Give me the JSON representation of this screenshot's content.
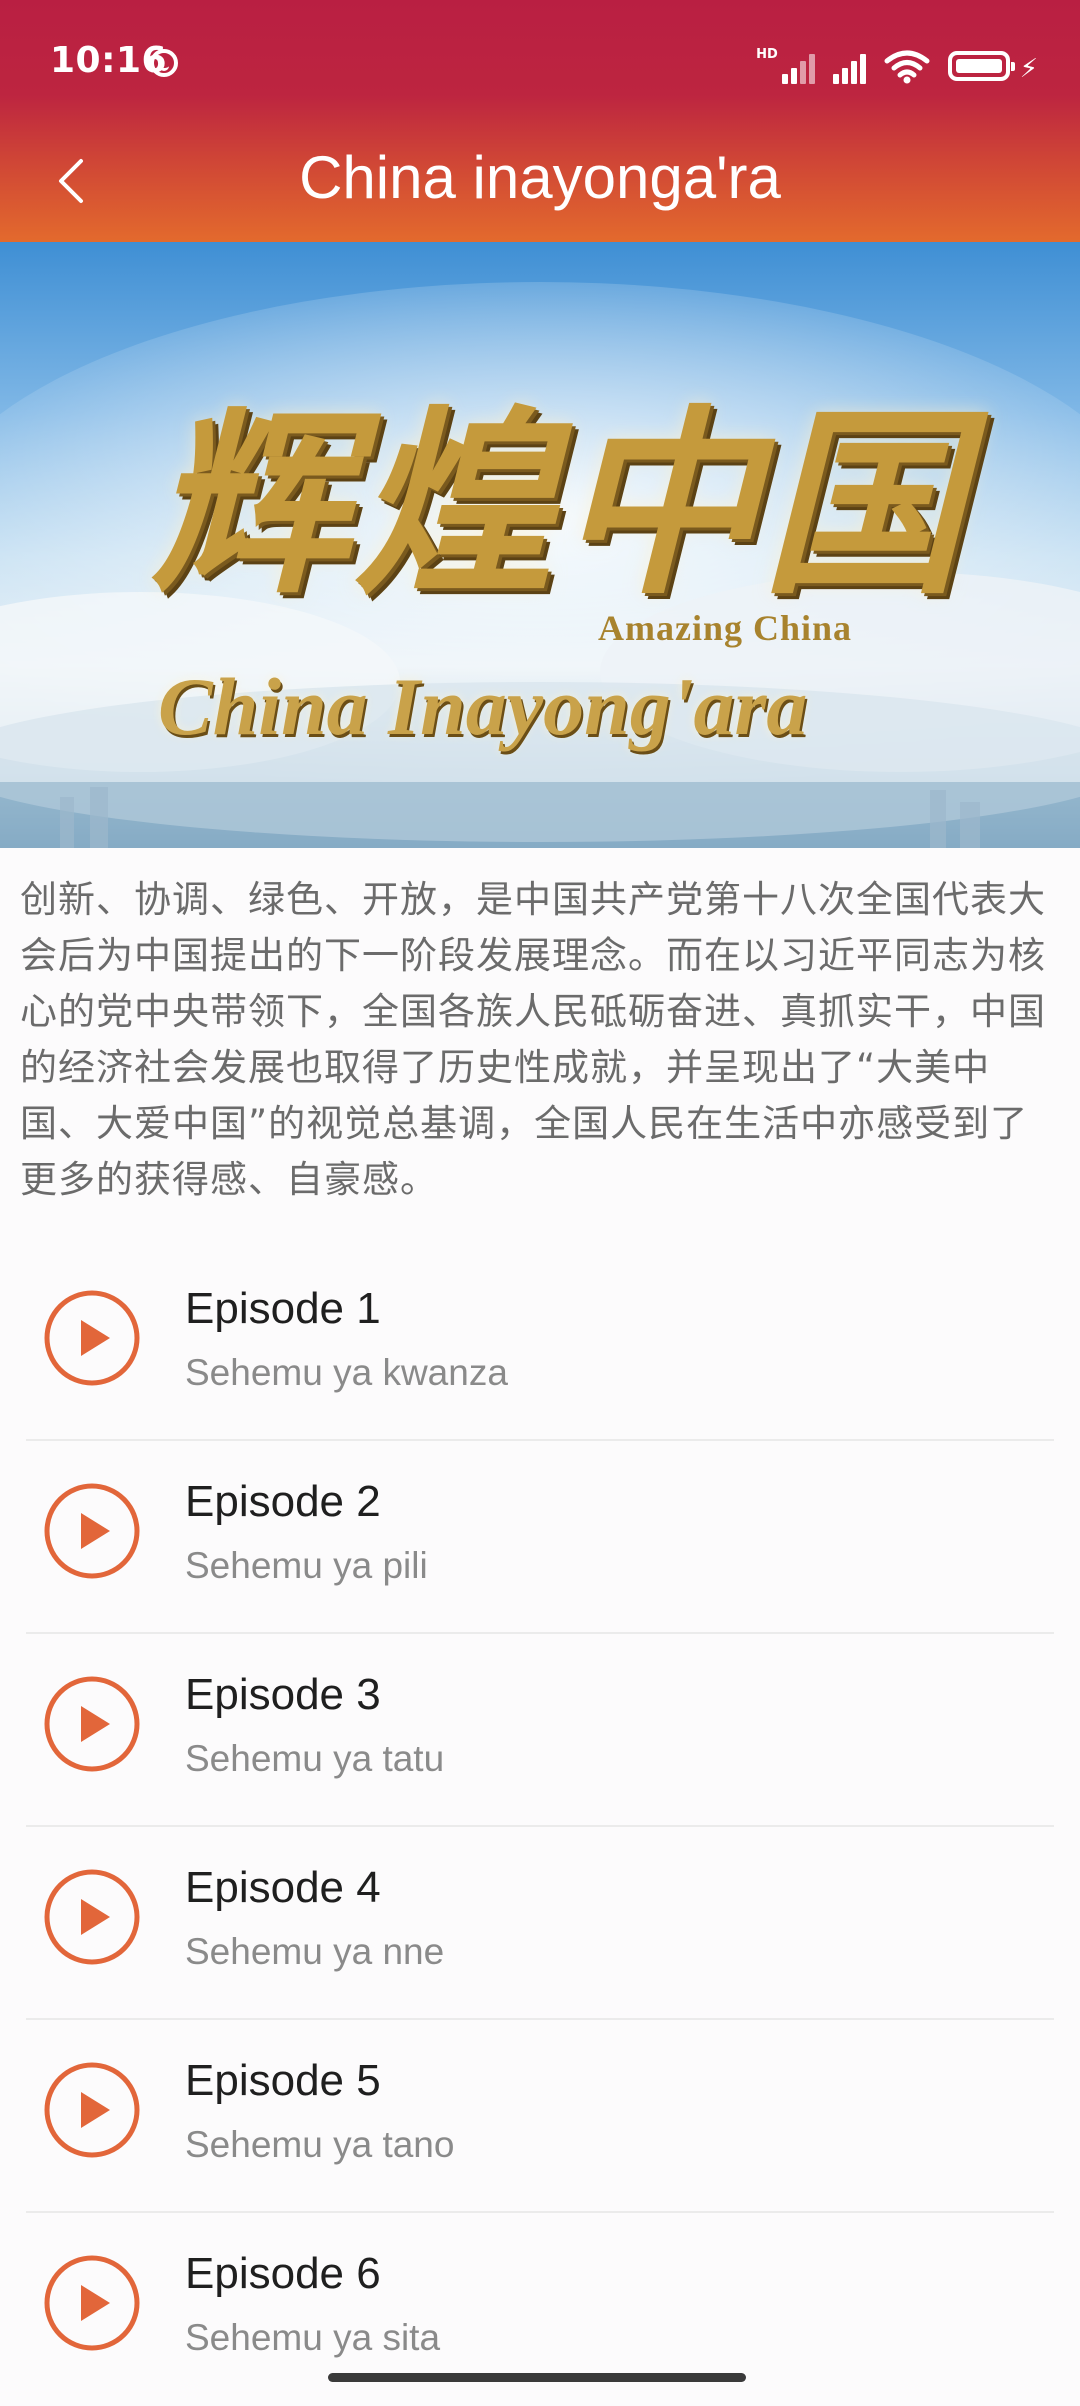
{
  "status_bar": {
    "time": "10:16",
    "network_label": "HD",
    "icons": [
      "face-icon",
      "hd-signal-icon",
      "signal-icon",
      "wifi-icon",
      "battery-icon",
      "charging-icon"
    ]
  },
  "header": {
    "back_icon": "chevron-left-icon",
    "title": "China inayonga'ra"
  },
  "hero": {
    "cjk_title": "辉煌中国",
    "english_title": "Amazing China",
    "subtitle": "China Inayong'ara"
  },
  "description": "创新、协调、绿色、开放，是中国共产党第十八次全国代表大会后为中国提出的下一阶段发展理念。而在以习近平同志为核心的党中央带领下，全国各族人民砥砺奋进、真抓实干，中国的经济社会发展也取得了历史性成就，并呈现出了“大美中国、大爱中国”的视觉总基调，全国人民在生活中亦感受到了更多的获得感、自豪感。",
  "colors": {
    "header_top": "#b91f42",
    "header_bottom": "#e36a2d",
    "play_accent": "#e2663a",
    "title_text": "#1f1f1f",
    "subtitle_text": "#8a8a8a"
  },
  "episodes": [
    {
      "title": "Episode 1",
      "subtitle": "Sehemu ya kwanza"
    },
    {
      "title": "Episode 2",
      "subtitle": "Sehemu ya pili"
    },
    {
      "title": "Episode 3",
      "subtitle": "Sehemu ya tatu"
    },
    {
      "title": "Episode 4",
      "subtitle": "Sehemu ya nne"
    },
    {
      "title": "Episode 5",
      "subtitle": "Sehemu ya tano"
    },
    {
      "title": "Episode 6",
      "subtitle": "Sehemu ya sita"
    }
  ]
}
